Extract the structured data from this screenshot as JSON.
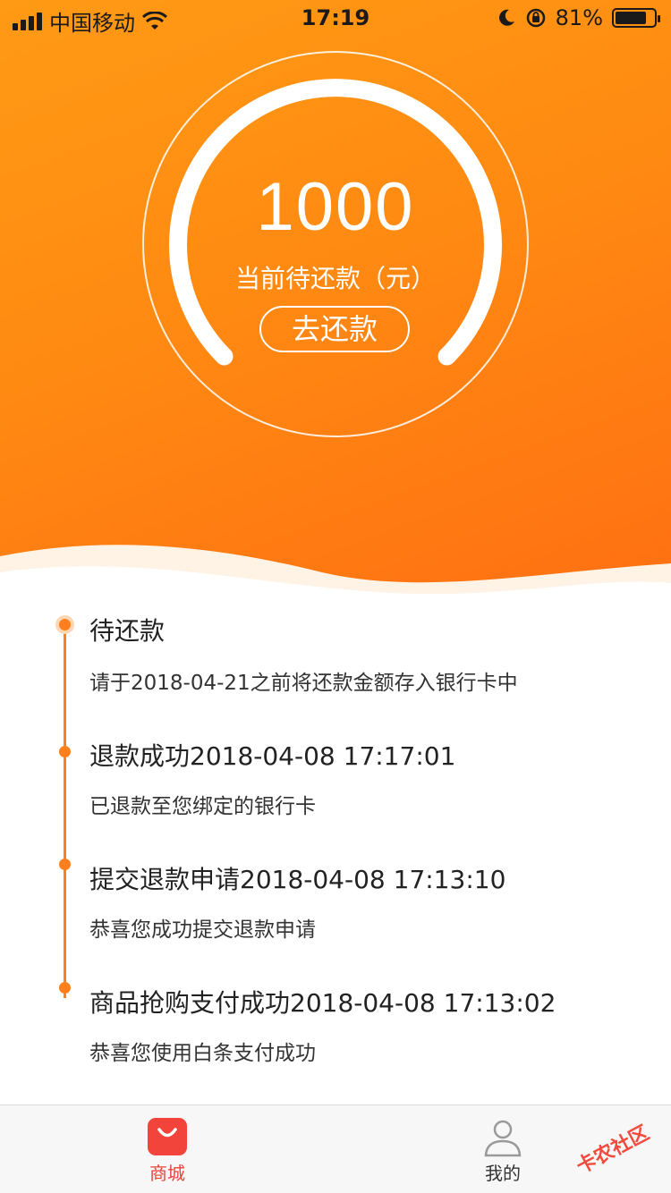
{
  "status_bar": {
    "carrier": "中国移动",
    "time": "17:19",
    "battery_percent": "81%",
    "battery_level": 0.81,
    "icons": [
      "signal-icon",
      "wifi-icon",
      "moon-icon",
      "rotation-lock-icon",
      "battery-icon"
    ]
  },
  "summary": {
    "amount": "1000",
    "amount_label": "当前待还款（元）",
    "repay_button": "去还款"
  },
  "timeline": [
    {
      "title": "待还款",
      "desc": "请于2018-04-21之前将还款金额存入银行卡中",
      "active": true
    },
    {
      "title": "退款成功2018-04-08 17:17:01",
      "desc": "已退款至您绑定的银行卡",
      "active": false
    },
    {
      "title": "提交退款申请2018-04-08 17:13:10",
      "desc": "恭喜您成功提交退款申请",
      "active": false
    },
    {
      "title": "商品抢购支付成功2018-04-08 17:13:02",
      "desc": "恭喜您使用白条支付成功",
      "active": false
    }
  ],
  "tabbar": {
    "shop_label": "商城",
    "mine_label": "我的",
    "selected": "商城"
  },
  "watermark": "卡农社区",
  "colors": {
    "accent": "#ff8a12",
    "timeline": "#ff7f1f",
    "tab_active": "#e8413a"
  }
}
